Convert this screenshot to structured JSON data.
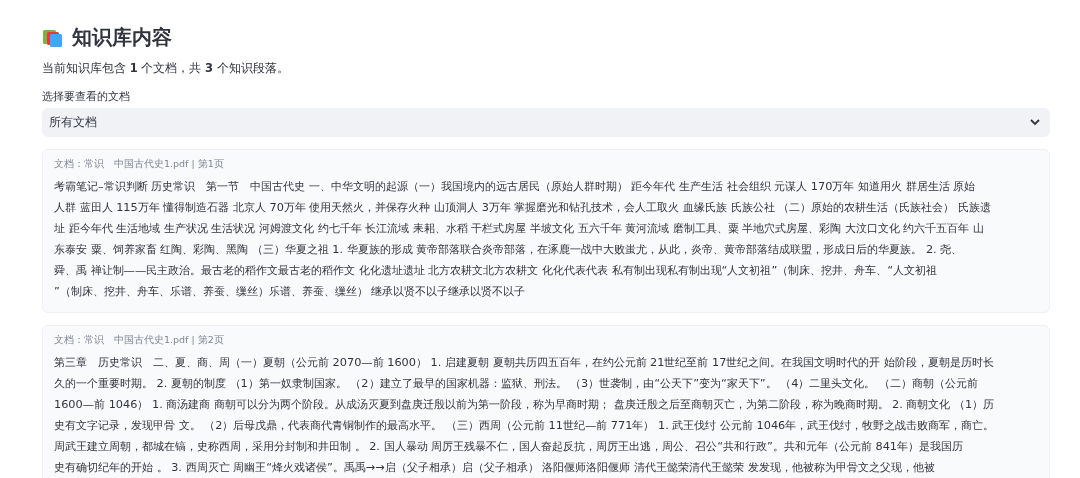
{
  "header": {
    "title": "知识库内容",
    "summary": "当前知识库包含 **1** 个文档，共 **3** 个知识段落。"
  },
  "document_select": {
    "label": "选择要查看的文档",
    "value": "所有文档"
  },
  "chunks": [
    {
      "meta": "文档：常识　中国古代史1.pdf | 第1页",
      "lines": [
        "考霸笔记–常识判断 历史常识　第一节　中国古代史 一、中华文明的起源（一）我国境内的远古居民（原始人群时期） 距今年代 生产生活 社会组织 元谋人 170万年 知道用火 群居生活 原始",
        "人群 蓝田人 115万年 懂得制造石器 北京人 70万年 使用天然火，并保存火种 山顶洞人 3万年 掌握磨光和钻孔技术，会人工取火 血缘氏族 氏族公社 （二）原始的农耕生活（氏族社会） 氏族遗",
        "址 距今年代 生活地域 生产状况 生活状况 河姆渡文化 约七千年 长江流域 耒耜、水稻 干栏式房屋 半坡文化 五六千年 黄河流域 磨制工具、粟 半地穴式房屋、彩陶 大汶口文化 约六千五百年 山",
        "东泰安 粟、饲养家畜 红陶、彩陶、黑陶 （三）华夏之祖 1. 华夏族的形成 黄帝部落联合炎帝部落，在涿鹿一战中大败蚩尤，从此，炎帝、黄帝部落结成联盟，形成日后的华夏族。 2. 尧、",
        "舜、禹 禅让制——民主政治。最古老的稻作文最古老的稻作文 化化遗址遗址 北方农耕文北方农耕文 化化代表代表 私有制出现私有制出现“人文初祖”（制床、挖井、舟车、“人文初祖",
        "”（制床、挖井、舟车、乐谱、养蚕、缫丝）乐谱、养蚕、缫丝） 继承以贤不以子继承以贤不以子"
      ]
    },
    {
      "meta": "文档：常识　中国古代史1.pdf | 第2页",
      "lines": [
        "第三章　历史常识　二、夏、商、周（一）夏朝（公元前 2070—前 1600） 1. 启建夏朝 夏朝共历四五百年，在约公元前 21世纪至前 17世纪之间。在我国文明时代的开 始阶段，夏朝是历时长",
        "久的一个重要时期。 2. 夏朝的制度 （1）第一奴隶制国家。 （2）建立了最早的国家机器：监狱、刑法。 （3）世袭制，由“公天下”变为“家天下”。 （4）二里头文化。 （二）商朝（公元前",
        "1600—前 1046） 1. 商汤建商 商朝可以分为两个阶段。从成汤灭夏到盘庚迁殷以前为第一阶段，称为早商时期； 盘庚迁殷之后至商朝灭亡，为第二阶段，称为晚商时期。 2. 商朝文化 （1）历",
        "史有文字记录，发现甲骨 文。 （2）后母戊鼎，代表商代青铜制作的最高水平。 （三）西周（公元前 11世纪—前 771年） 1. 武王伐纣 公元前 1046年，武王伐纣，牧野之战击败商军，商亡。",
        "周武王建立周朝，都城在镐，史称西周，采用分封制和井田制 。 2. 国人暴动 周厉王残暴不仁，国人奋起反抗，周厉王出逃，周公、召公“共和行政”。共和元年（公元前 841年）是我国历",
        "史有确切纪年的开始 。 3. 西周灭亡 周幽王“烽火戏诸侯”。禹禹→→启（父子相承）启（父子相承） 洛阳偃师洛阳偃师 清代王懿荣清代王懿荣 发发现，他被称为甲骨文之父现，他被"
      ]
    }
  ]
}
